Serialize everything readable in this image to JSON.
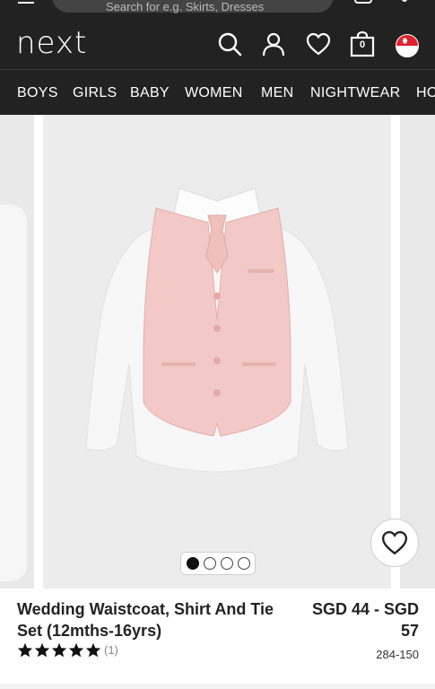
{
  "header": {
    "logo": "next",
    "search_placeholder": "Search for e.g. Skirts, Dresses",
    "bag_count": "0",
    "region": "SG"
  },
  "nav": {
    "items": [
      "BOYS",
      "GIRLS",
      "BABY",
      "WOMEN",
      "MEN",
      "NIGHTWEAR",
      "HOME"
    ]
  },
  "carousel": {
    "total_images": 4,
    "active_index": 0
  },
  "product": {
    "title": "Wedding Waistcoat, Shirt And Tie Set (12mths-16yrs)",
    "price_line1": "SGD 44 - SGD",
    "price_line2": "57",
    "rating_stars": 5,
    "review_count": "(1)",
    "item_code": "284-150"
  },
  "colors": {
    "header_bg": "#222222",
    "waistcoat": "#f2c9c6",
    "shirt": "#ffffff",
    "star": "#111111"
  }
}
